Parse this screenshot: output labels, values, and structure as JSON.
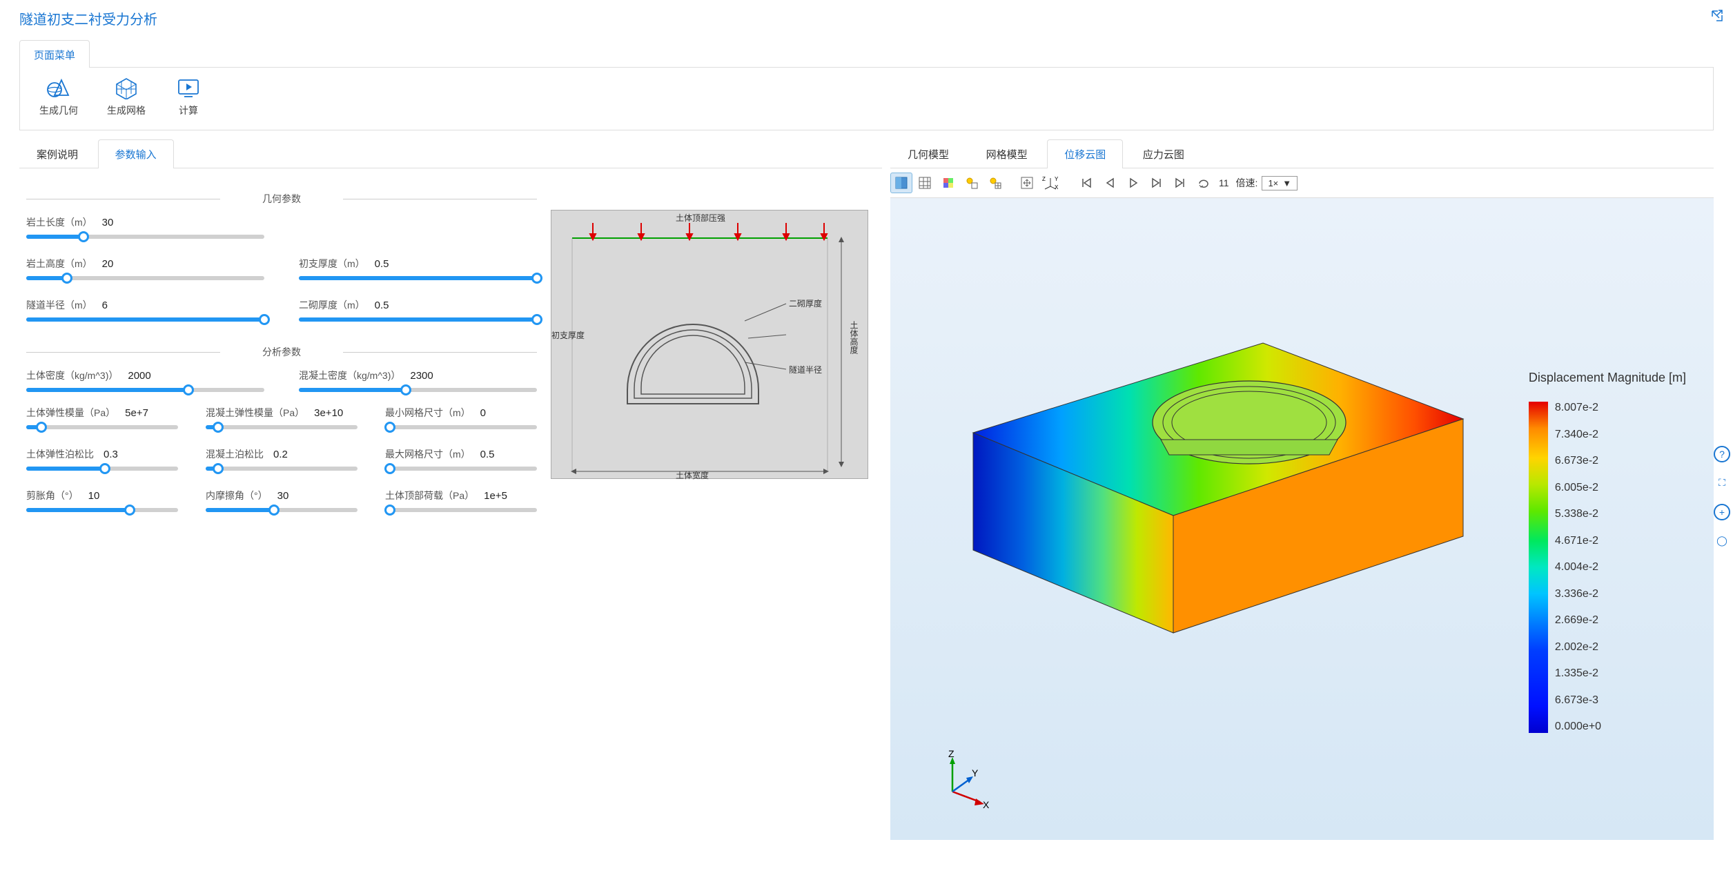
{
  "app_title": "隧道初支二衬受力分析",
  "page_menu_tab": "页面菜单",
  "toolbar": {
    "gen_geom": "生成几何",
    "gen_mesh": "生成网格",
    "compute": "计算"
  },
  "left_tabs": {
    "case": "案例说明",
    "params": "参数输入"
  },
  "sections": {
    "geom": "几何参数",
    "analysis": "分析参数"
  },
  "params": {
    "rock_length": {
      "label": "岩土长度（m）",
      "value": "30",
      "pct": 24
    },
    "rock_height": {
      "label": "岩土高度（m）",
      "value": "20",
      "pct": 17
    },
    "tunnel_radius": {
      "label": "隧道半径（m）",
      "value": "6",
      "pct": 100
    },
    "primary_thickness": {
      "label": "初支厚度（m）",
      "value": "0.5",
      "pct": 100
    },
    "secondary_thickness": {
      "label": "二砌厚度（m）",
      "value": "0.5",
      "pct": 100
    },
    "soil_density": {
      "label": "土体密度（kg/m^3)）",
      "value": "2000",
      "pct": 68
    },
    "concrete_density": {
      "label": "混凝土密度（kg/m^3)）",
      "value": "2300",
      "pct": 45
    },
    "soil_e": {
      "label": "土体弹性模量（Pa）",
      "value": "5e+7",
      "pct": 10
    },
    "concrete_e": {
      "label": "混凝土弹性模量（Pa）",
      "value": "3e+10",
      "pct": 8
    },
    "min_mesh": {
      "label": "最小网格尺寸（m）",
      "value": "0",
      "pct": 3
    },
    "soil_poisson": {
      "label": "土体弹性泊松比",
      "value": "0.3",
      "pct": 52
    },
    "concrete_poisson": {
      "label": "混凝土泊松比",
      "value": "0.2",
      "pct": 8
    },
    "max_mesh": {
      "label": "最大网格尺寸（m）",
      "value": "0.5",
      "pct": 3
    },
    "dilation_angle": {
      "label": "剪胀角（°）",
      "value": "10",
      "pct": 68
    },
    "friction_angle": {
      "label": "内摩擦角（°）",
      "value": "30",
      "pct": 45
    },
    "top_load": {
      "label": "土体顶部荷载（Pa）",
      "value": "1e+5",
      "pct": 3
    }
  },
  "diagram": {
    "top_pressure": "土体顶部压强",
    "secondary_thk": "二砌厚度",
    "primary_thk": "初支厚度",
    "tunnel_r": "隧道半径",
    "soil_height": "土体高度",
    "soil_width": "土体宽度"
  },
  "right_tabs": {
    "geom": "几何模型",
    "mesh": "网格模型",
    "disp": "位移云图",
    "stress": "应力云图"
  },
  "playback": {
    "frame": "11",
    "speed_label": "倍速:",
    "speed_value": "1×"
  },
  "legend": {
    "title": "Displacement Magnitude [m]",
    "values": [
      "8.007e-2",
      "7.340e-2",
      "6.673e-2",
      "6.005e-2",
      "5.338e-2",
      "4.671e-2",
      "4.004e-2",
      "3.336e-2",
      "2.669e-2",
      "2.002e-2",
      "1.335e-2",
      "6.673e-3",
      "0.000e+0"
    ]
  },
  "axes": {
    "x": "X",
    "y": "Y",
    "z": "Z"
  }
}
